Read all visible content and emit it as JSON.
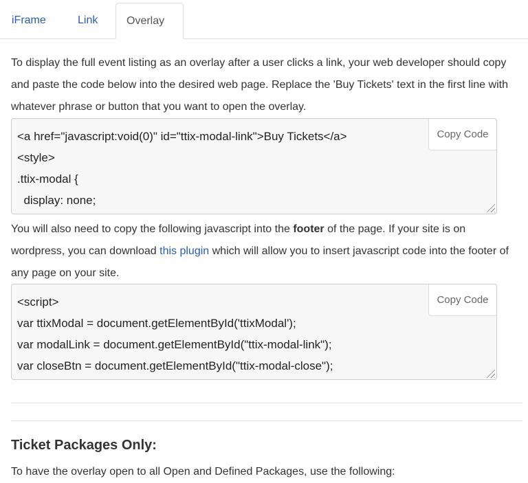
{
  "tabs": [
    {
      "label": "iFrame"
    },
    {
      "label": "Link"
    },
    {
      "label": "Overlay"
    }
  ],
  "intro": "To display the full event listing as an overlay after a user clicks a link, your web developer should copy and paste the code below into the desired web page. Replace the 'Buy Tickets' text in the first line with whatever phrase or button that you want to open the overlay.",
  "code1": "<a href=\"javascript:void(0)\" id=\"ttix-modal-link\">Buy Tickets</a>\n<style>\n.ttix-modal {\n  display: none;",
  "copy_label": "Copy Code",
  "para2": {
    "before": "You will also need to copy the following javascript into the ",
    "bold": "footer",
    "middle": " of the page. If your site is on wordpress, you can download ",
    "link": "this plugin",
    "after": " which will allow you to insert javascript code into the footer of any page on your site."
  },
  "code2": "<script>\nvar ttixModal = document.getElementById('ttixModal');\nvar modalLink = document.getElementById(\"ttix-modal-link\");\nvar closeBtn = document.getElementById(\"ttix-modal-close\");",
  "heading": "Ticket Packages Only:",
  "para3": "To have the overlay open to all Open and Defined Packages, use the following:"
}
